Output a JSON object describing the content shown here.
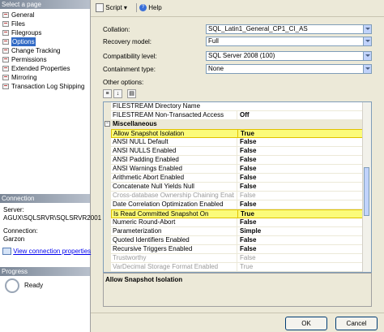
{
  "left_panel": {
    "select_page_header": "Select a page",
    "pages": [
      {
        "label": "General",
        "selected": false
      },
      {
        "label": "Files",
        "selected": false
      },
      {
        "label": "Filegroups",
        "selected": false
      },
      {
        "label": "Options",
        "selected": true
      },
      {
        "label": "Change Tracking",
        "selected": false
      },
      {
        "label": "Permissions",
        "selected": false
      },
      {
        "label": "Extended Properties",
        "selected": false
      },
      {
        "label": "Mirroring",
        "selected": false
      },
      {
        "label": "Transaction Log Shipping",
        "selected": false
      }
    ],
    "connection_header": "Connection",
    "server_label": "Server:",
    "server_value": "AGUX\\SQLSRVR\\SQLSRVR2001",
    "connection_label": "Connection:",
    "connection_value": "Garzon",
    "view_connection_link": "View connection properties",
    "progress_header": "Progress",
    "progress_status": "Ready"
  },
  "toolbar": {
    "script_label": "Script",
    "help_label": "Help"
  },
  "form": {
    "collation_label": "Collation:",
    "collation_value": "SQL_Latin1_General_CP1_CI_AS",
    "recovery_label": "Recovery model:",
    "recovery_value": "Full",
    "compat_label": "Compatibility level:",
    "compat_value": "SQL Server 2008 (100)",
    "containment_label": "Containment type:",
    "containment_value": "None",
    "other_options_label": "Other options:"
  },
  "grid": {
    "rows": [
      {
        "name": "FILESTREAM Directory Name",
        "value": "",
        "type": "normal"
      },
      {
        "name": "FILESTREAM Non-Transacted Access",
        "value": "Off",
        "type": "normal"
      },
      {
        "name": "Miscellaneous",
        "value": "",
        "type": "category"
      },
      {
        "name": "Allow Snapshot Isolation",
        "value": "True",
        "type": "highlight"
      },
      {
        "name": "ANSI NULL Default",
        "value": "False",
        "type": "normal"
      },
      {
        "name": "ANSI NULLS Enabled",
        "value": "False",
        "type": "normal"
      },
      {
        "name": "ANSI Padding Enabled",
        "value": "False",
        "type": "normal"
      },
      {
        "name": "ANSI Warnings Enabled",
        "value": "False",
        "type": "normal"
      },
      {
        "name": "Arithmetic Abort Enabled",
        "value": "False",
        "type": "normal"
      },
      {
        "name": "Concatenate Null Yields Null",
        "value": "False",
        "type": "normal"
      },
      {
        "name": "Cross-database Ownership Chaining Enabled",
        "value": "False",
        "type": "disabled"
      },
      {
        "name": "Date Correlation Optimization Enabled",
        "value": "False",
        "type": "normal"
      },
      {
        "name": "Is Read Committed Snapshot On",
        "value": "True",
        "type": "highlight"
      },
      {
        "name": "Numeric Round-Abort",
        "value": "False",
        "type": "normal"
      },
      {
        "name": "Parameterization",
        "value": "Simple",
        "type": "normal"
      },
      {
        "name": "Quoted Identifiers Enabled",
        "value": "False",
        "type": "normal"
      },
      {
        "name": "Recursive Triggers Enabled",
        "value": "False",
        "type": "normal"
      },
      {
        "name": "Trustworthy",
        "value": "False",
        "type": "disabled"
      },
      {
        "name": "VarDecimal Storage Format Enabled",
        "value": "True",
        "type": "disabled"
      }
    ],
    "description": "Allow Snapshot Isolation"
  },
  "buttons": {
    "ok": "OK",
    "cancel": "Cancel"
  }
}
